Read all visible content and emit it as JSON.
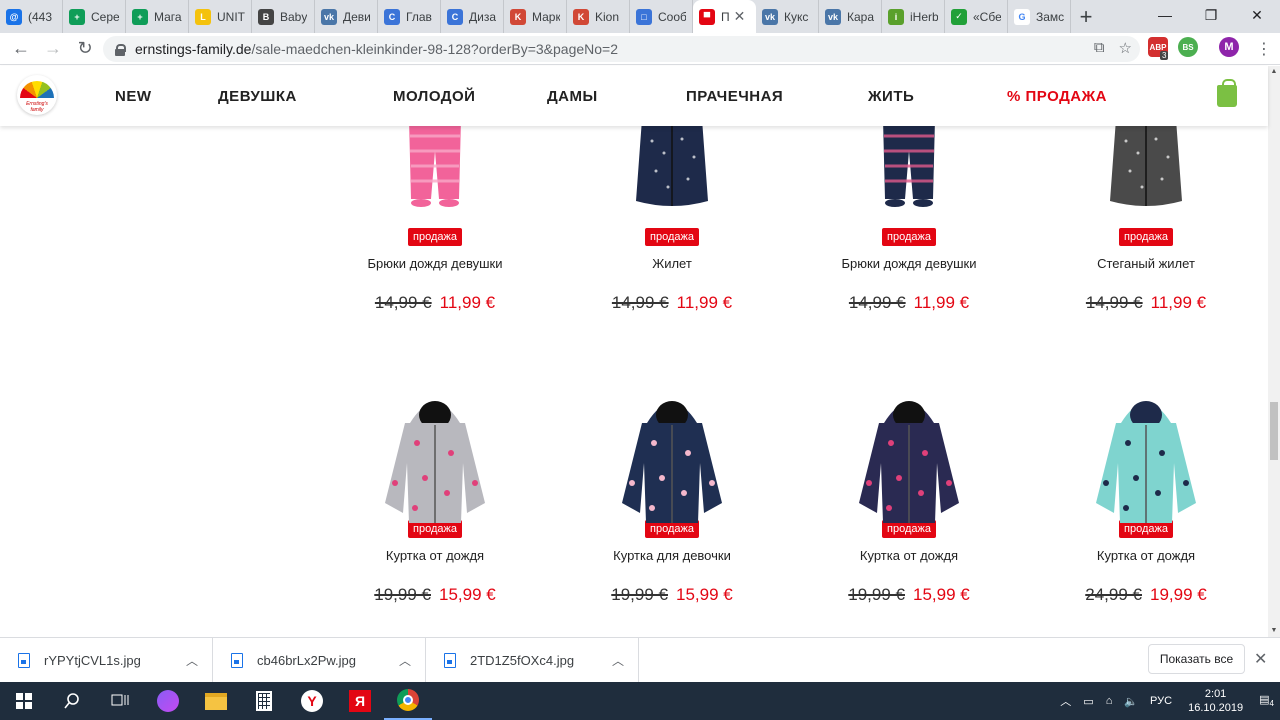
{
  "browser": {
    "tabs": [
      {
        "label": "(443",
        "color": "#1a73e8",
        "glyph": "@"
      },
      {
        "label": "Сере",
        "color": "#0f9d58",
        "glyph": "+"
      },
      {
        "label": "Мага",
        "color": "#0f9d58",
        "glyph": "+"
      },
      {
        "label": "UNIT",
        "color": "#f4c20d",
        "glyph": "L"
      },
      {
        "label": "Baby",
        "color": "#444444",
        "glyph": "B"
      },
      {
        "label": "Деви",
        "color": "#4a76a8",
        "glyph": "vk"
      },
      {
        "label": "Глав",
        "color": "#3b74d8",
        "glyph": "C"
      },
      {
        "label": "Диза",
        "color": "#3b74d8",
        "glyph": "C"
      },
      {
        "label": "Марк",
        "color": "#d14836",
        "glyph": "K"
      },
      {
        "label": "Kion",
        "color": "#d14836",
        "glyph": "K"
      },
      {
        "label": "Сооб",
        "color": "#3b74d8",
        "glyph": "□"
      },
      {
        "label": "П",
        "color": "#e30613",
        "glyph": "▀",
        "active": true
      },
      {
        "label": "Кукс",
        "color": "#4a76a8",
        "glyph": "vk"
      },
      {
        "label": "Кара",
        "color": "#4a76a8",
        "glyph": "vk"
      },
      {
        "label": "iHerb",
        "color": "#5aa02c",
        "glyph": "i"
      },
      {
        "label": "«Сбе",
        "color": "#21a038",
        "glyph": "✓"
      },
      {
        "label": "Замс",
        "color": "#ffffff",
        "glyph": "G"
      }
    ],
    "url_host": "ernstings-family.de",
    "url_path": "/sale-maedchen-kleinkinder-98-128?orderBy=3&pageNo=2",
    "ext_abp_count": "3",
    "profile_initial": "M"
  },
  "site": {
    "nav": [
      "NEW",
      "ДЕВУШКА",
      "МОЛОДОЙ",
      "ДАМЫ",
      "ПРАЧЕЧНАЯ",
      "ЖИТЬ",
      "% ПРОДАЖА"
    ],
    "logo_text": "Ernsting's family",
    "colors": {
      "accent": "#e30613",
      "bag": "#7bc043"
    }
  },
  "products": [
    {
      "badge": "продажа",
      "name": "Брюки дождя девушки",
      "old": "14,99 €",
      "new": "11,99 €",
      "kind": "pants",
      "color": "#f2639a",
      "accent": "#f9a8c8"
    },
    {
      "badge": "продажа",
      "name": "Жилет",
      "old": "14,99 €",
      "new": "11,99 €",
      "kind": "vest",
      "color": "#1e2a4a",
      "accent": "#f06ba0"
    },
    {
      "badge": "продажа",
      "name": "Брюки дождя девушки",
      "old": "14,99 €",
      "new": "11,99 €",
      "kind": "pants",
      "color": "#1e2a4a",
      "accent": "#e05a8c"
    },
    {
      "badge": "продажа",
      "name": "Стеганый жилет",
      "old": "14,99 €",
      "new": "11,99 €",
      "kind": "vest",
      "color": "#4a4a4a",
      "accent": "#f2a0b8"
    },
    {
      "badge": "продажа",
      "name": "Куртка от дождя",
      "old": "19,99 €",
      "new": "15,99 €",
      "kind": "jacket",
      "color": "#b8b8be",
      "accent": "#e0407a"
    },
    {
      "badge": "продажа",
      "name": "Куртка для девочки",
      "old": "19,99 €",
      "new": "15,99 €",
      "kind": "jacket",
      "color": "#1f2f52",
      "accent": "#f4b8cc"
    },
    {
      "badge": "продажа",
      "name": "Куртка от дождя",
      "old": "19,99 €",
      "new": "15,99 €",
      "kind": "jacket",
      "color": "#2a2a52",
      "accent": "#e0407a"
    },
    {
      "badge": "продажа",
      "name": "Куртка от дождя",
      "old": "24,99 €",
      "new": "19,99 €",
      "kind": "jacket",
      "color": "#7fd4cf",
      "accent": "#1e2a4a"
    }
  ],
  "downloads": {
    "files": [
      "rYPYtjCVL1s.jpg",
      "cb46brLx2Pw.jpg",
      "2TD1Z5fOXc4.jpg"
    ],
    "show_all": "Показать все"
  },
  "taskbar": {
    "lang": "РУС",
    "time": "2:01",
    "date": "16.10.2019",
    "notif_count": "4"
  }
}
